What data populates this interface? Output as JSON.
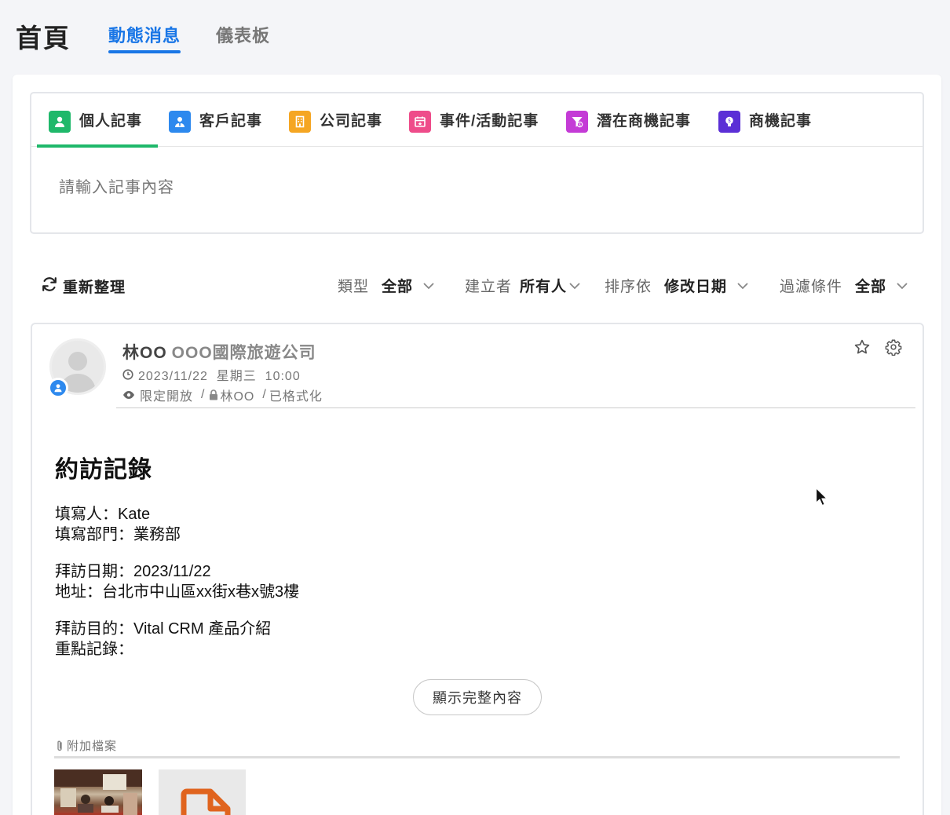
{
  "header": {
    "title": "首頁",
    "tabs": [
      {
        "label": "動態消息",
        "active": true
      },
      {
        "label": "儀表板",
        "active": false
      }
    ]
  },
  "composer": {
    "tabs": [
      {
        "label": "個人記事",
        "icon": "person-icon",
        "color": "#1fb86a",
        "active": true
      },
      {
        "label": "客戶記事",
        "icon": "customer-icon",
        "color": "#2d89ee",
        "active": false
      },
      {
        "label": "公司記事",
        "icon": "building-icon",
        "color": "#f5a623",
        "active": false
      },
      {
        "label": "事件/活動記事",
        "icon": "calendar-icon",
        "color": "#ee4c8a",
        "active": false
      },
      {
        "label": "潛在商機記事",
        "icon": "funnel-icon",
        "color": "#c43bd6",
        "active": false
      },
      {
        "label": "商機記事",
        "icon": "lightbulb-icon",
        "color": "#5b2fd6",
        "active": false
      }
    ],
    "placeholder": "請輸入記事內容"
  },
  "filters": {
    "refresh_label": "重新整理",
    "type": {
      "label": "類型",
      "value": "全部"
    },
    "creator": {
      "label": "建立者",
      "value": "所有人"
    },
    "sort": {
      "label": "排序依",
      "value": "修改日期"
    },
    "filter": {
      "label": "過濾條件",
      "value": "全部"
    }
  },
  "post": {
    "author": "林OO",
    "company": "OOO國際旅遊公司",
    "datetime": "2023/11/22  星期三  10:00",
    "visibility": "限定開放",
    "owner": "林OO",
    "format": "已格式化",
    "heading": "約訪記錄",
    "lines": [
      "填寫人：Kate",
      "填寫部門：業務部",
      "",
      "拜訪日期：2023/11/22",
      "地址：台北市中山區xx街x巷x號3樓",
      "",
      "拜訪目的：Vital CRM 產品介紹",
      "重點記錄："
    ],
    "show_more_label": "顯示完整內容",
    "attachments_label": "附加檔案"
  }
}
